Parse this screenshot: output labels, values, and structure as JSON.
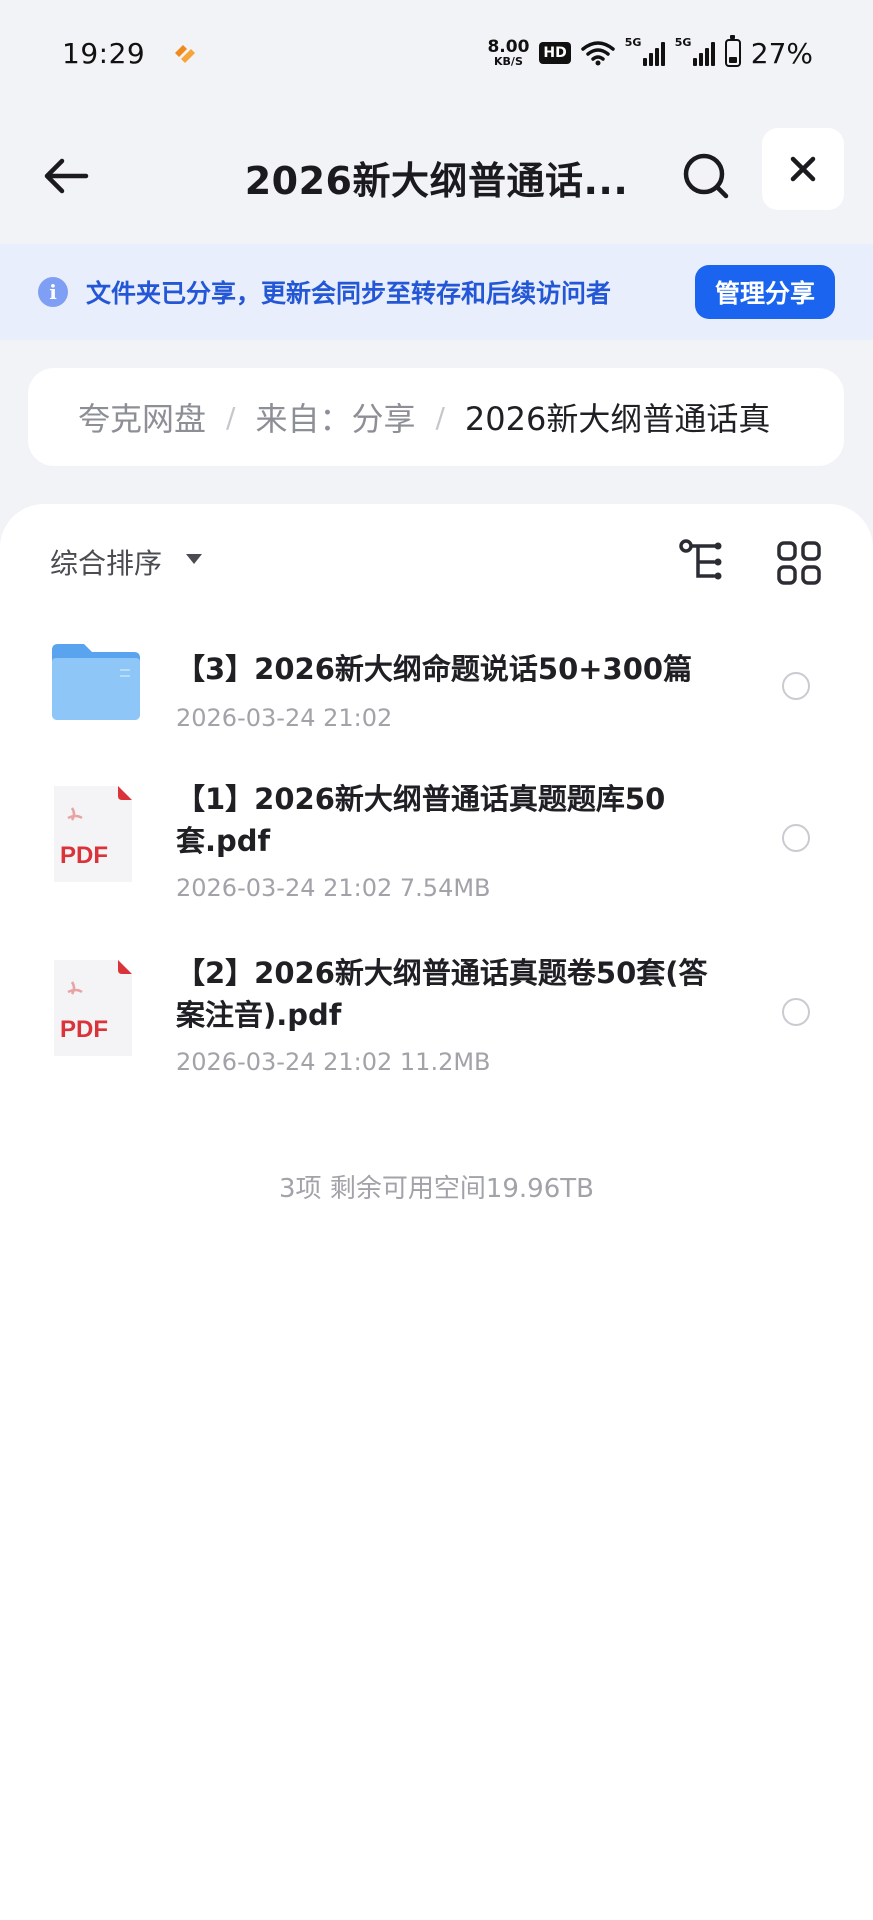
{
  "status_bar": {
    "time": "19:29",
    "net_speed_value": "8.00",
    "net_speed_unit": "KB/S",
    "hd_badge": "HD",
    "sim1_label": "5G",
    "sim2_label": "5G",
    "battery_percent": "27%"
  },
  "header": {
    "title": "2026新大纲普通话..."
  },
  "banner": {
    "text": "文件夹已分享，更新会同步至转存和后续访问者",
    "manage_label": "管理分享",
    "info_glyph": "i"
  },
  "breadcrumb": {
    "items": [
      "夸克网盘",
      "来自：分享",
      "2026新大纲普通话真"
    ],
    "separator": "/"
  },
  "toolbar": {
    "sort_label": "综合排序"
  },
  "files": [
    {
      "type": "folder",
      "name": "【3】2026新大纲命题说话50+300篇",
      "meta": "2026-03-24 21:02"
    },
    {
      "type": "pdf",
      "name": "【1】2026新大纲普通话真题题库50套.pdf",
      "meta": "2026-03-24 21:02  7.54MB",
      "badge": "PDF"
    },
    {
      "type": "pdf",
      "name": "【2】2026新大纲普通话真题卷50套(答案注音).pdf",
      "meta": "2026-03-24 21:02  11.2MB",
      "badge": "PDF"
    }
  ],
  "summary": "3项 剩余可用空间19.96TB",
  "colors": {
    "accent": "#1a64f0",
    "banner_bg": "#e8eefc",
    "banner_text": "#2457d6",
    "pdf_red": "#d8343a",
    "folder_blue": "#6fb2f4"
  }
}
